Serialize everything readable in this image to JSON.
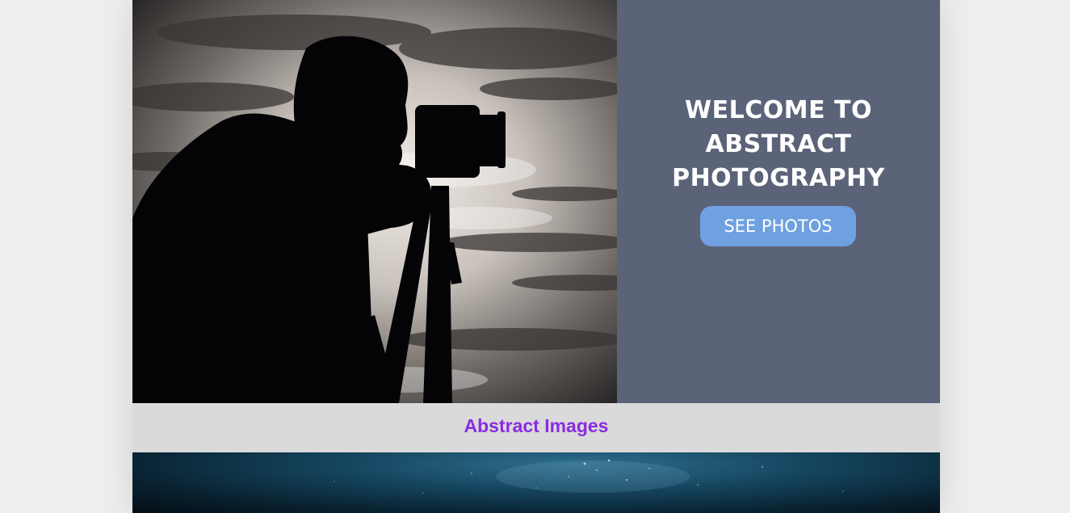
{
  "hero": {
    "title": "WELCOME TO ABSTRACT PHOTOGRAPHY",
    "button_label": "SEE PHOTOS",
    "photo_icon": "photographer-silhouette-image"
  },
  "gallery": {
    "heading": "Abstract Images",
    "first_image_icon": "night-sky-image"
  },
  "colors": {
    "page_background": "#eeeeee",
    "hero_panel": "#5b6378",
    "button": "#6fa0e0",
    "gallery_bar": "#dadada",
    "gallery_heading": "#8a2be2"
  }
}
